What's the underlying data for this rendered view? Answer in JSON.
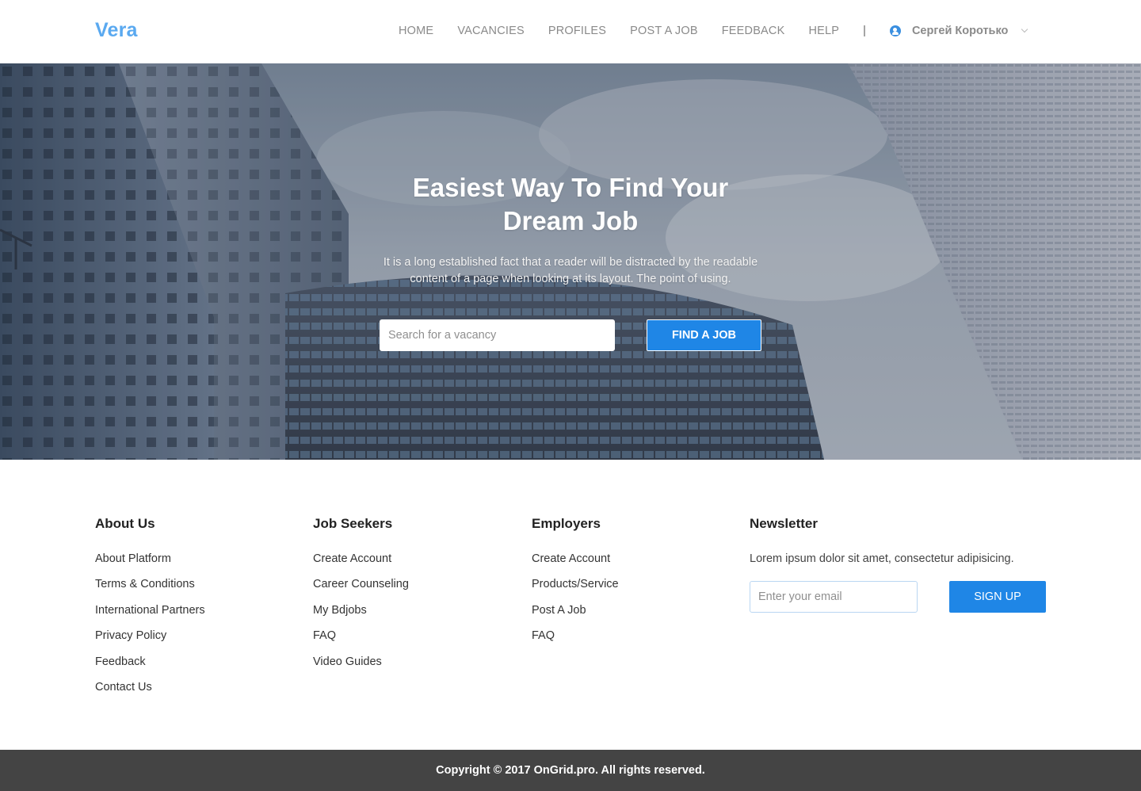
{
  "header": {
    "logo": "Vera",
    "nav": [
      "HOME",
      "VACANCIES",
      "PROFILES",
      "POST A JOB",
      "FEEDBACK",
      "HELP"
    ],
    "separator": "|",
    "user_name": "Сергей Коротько",
    "user_icon": "user-circle-icon",
    "dropdown_icon": "chevron-down-icon"
  },
  "hero": {
    "title_line1": "Easiest Way To Find Your",
    "title_line2": "Dream Job",
    "text": "It is a long established fact that a reader will be distracted by the readable content of a page when looking at its layout. The point of using.",
    "search_placeholder": "Search for a vacancy",
    "button_label": "FIND A JOB"
  },
  "footer": {
    "about": {
      "title": "About Us",
      "links": [
        "About Platform",
        "Terms & Conditions",
        "International Partners",
        "Privacy Policy",
        "Feedback",
        "Contact Us"
      ]
    },
    "seekers": {
      "title": "Job Seekers",
      "links": [
        "Create Account",
        "Career Counseling",
        "My Bdjobs",
        "FAQ",
        "Video Guides"
      ]
    },
    "employers": {
      "title": "Employers",
      "links": [
        "Create Account",
        "Products/Service",
        "Post A Job",
        "FAQ"
      ]
    },
    "newsletter": {
      "title": "Newsletter",
      "text": "Lorem ipsum dolor sit amet, consectetur adipisicing.",
      "email_placeholder": "Enter your email",
      "button_label": "SIGN UP"
    }
  },
  "copyright": "Copyright © 2017 OnGrid.pro. All rights reserved.",
  "colors": {
    "accent": "#1f86e6",
    "logo": "#5aa9f0",
    "bottom_bar": "#444444"
  }
}
